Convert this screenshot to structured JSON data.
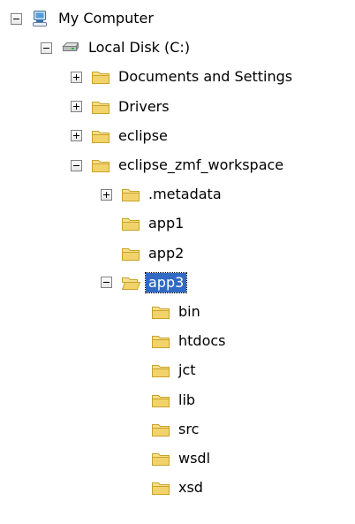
{
  "tree": [
    {
      "label": "My Computer",
      "icon": "computer-icon",
      "toggle": "expanded",
      "depth": 0,
      "selected": false
    },
    {
      "label": "Local Disk (C:)",
      "icon": "drive-icon",
      "toggle": "expanded",
      "depth": 1,
      "selected": false
    },
    {
      "label": "Documents and Settings",
      "icon": "folder-icon",
      "toggle": "collapsed",
      "depth": 2,
      "selected": false
    },
    {
      "label": "Drivers",
      "icon": "folder-icon",
      "toggle": "collapsed",
      "depth": 2,
      "selected": false
    },
    {
      "label": "eclipse",
      "icon": "folder-icon",
      "toggle": "collapsed",
      "depth": 2,
      "selected": false
    },
    {
      "label": "eclipse_zmf_workspace",
      "icon": "folder-icon",
      "toggle": "expanded",
      "depth": 2,
      "selected": false
    },
    {
      "label": ".metadata",
      "icon": "folder-icon",
      "toggle": "collapsed",
      "depth": 3,
      "selected": false
    },
    {
      "label": "app1",
      "icon": "folder-icon",
      "toggle": "none",
      "depth": 3,
      "selected": false
    },
    {
      "label": "app2",
      "icon": "folder-icon",
      "toggle": "none",
      "depth": 3,
      "selected": false
    },
    {
      "label": "app3",
      "icon": "folder-open-icon",
      "toggle": "expanded",
      "depth": 3,
      "selected": true
    },
    {
      "label": "bin",
      "icon": "folder-icon",
      "toggle": "none",
      "depth": 4,
      "selected": false
    },
    {
      "label": "htdocs",
      "icon": "folder-icon",
      "toggle": "none",
      "depth": 4,
      "selected": false
    },
    {
      "label": "jct",
      "icon": "folder-icon",
      "toggle": "none",
      "depth": 4,
      "selected": false
    },
    {
      "label": "lib",
      "icon": "folder-icon",
      "toggle": "none",
      "depth": 4,
      "selected": false
    },
    {
      "label": "src",
      "icon": "folder-icon",
      "toggle": "none",
      "depth": 4,
      "selected": false
    },
    {
      "label": "wsdl",
      "icon": "folder-icon",
      "toggle": "none",
      "depth": 4,
      "selected": false
    },
    {
      "label": "xsd",
      "icon": "folder-icon",
      "toggle": "none",
      "depth": 4,
      "selected": false
    }
  ],
  "colors": {
    "selection": "#316ac5",
    "folder": "#f2d36b",
    "folder_border": "#c9a227"
  }
}
